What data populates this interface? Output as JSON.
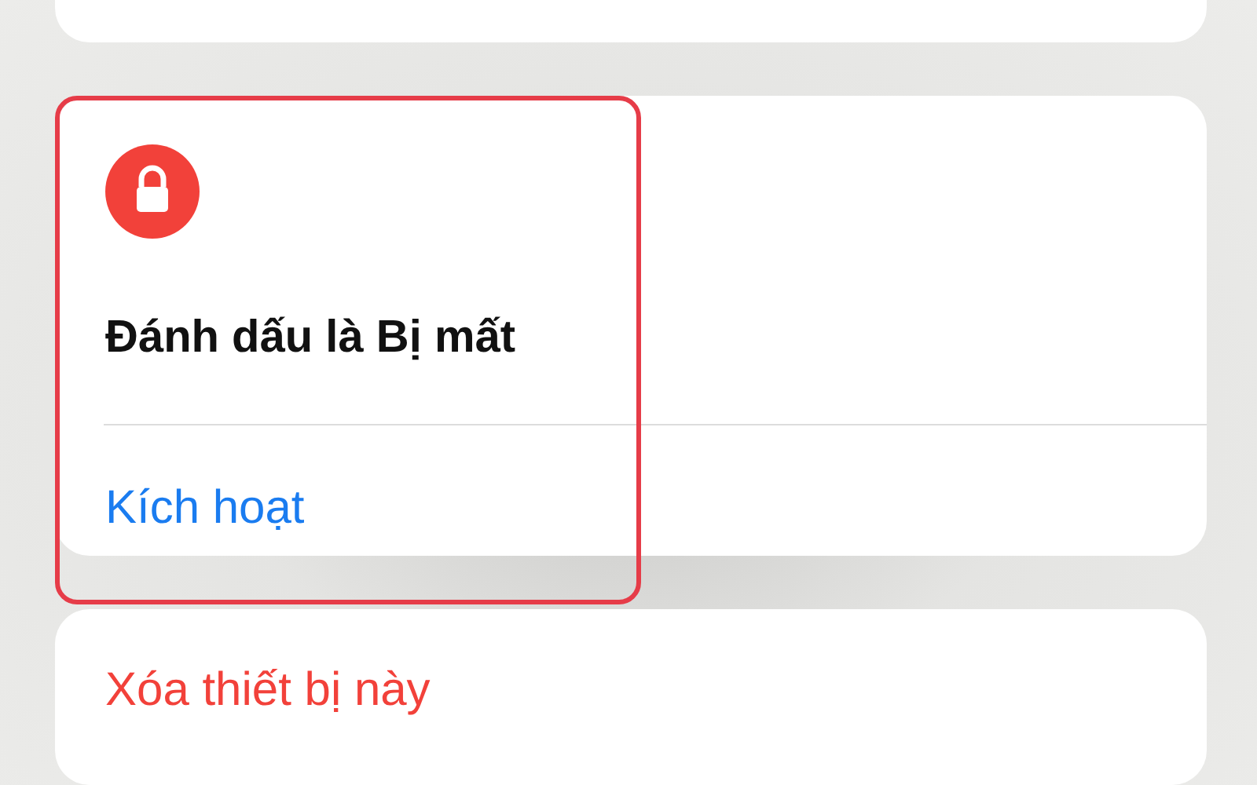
{
  "lost_mode": {
    "title": "Đánh dấu là Bị mất",
    "action": "Kích hoạt",
    "highlighted": true
  },
  "erase": {
    "label": "Xóa thiết bị này"
  }
}
